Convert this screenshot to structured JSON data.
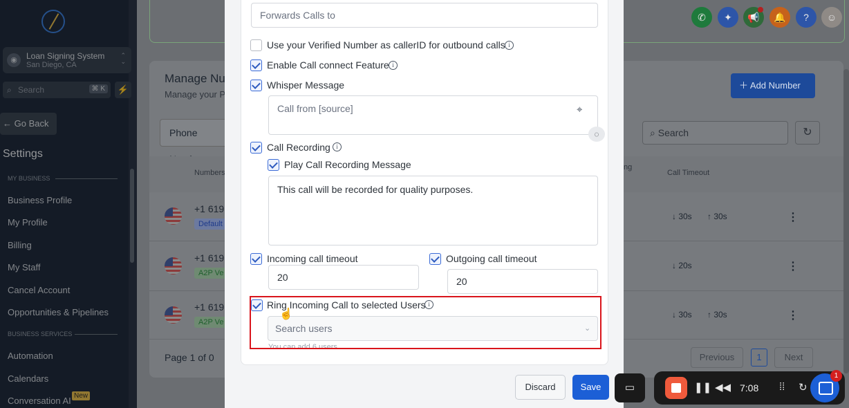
{
  "sidebar": {
    "logo_text": "",
    "account": {
      "name": "Loan Signing System",
      "location": "San Diego, CA"
    },
    "search": {
      "placeholder": "Search",
      "shortcut": "⌘ K"
    },
    "go_back": "← Go Back",
    "title": "Settings",
    "sections": [
      {
        "label": "MY BUSINESS"
      },
      {
        "label": "BUSINESS SERVICES"
      }
    ],
    "items": [
      {
        "label": "Business Profile"
      },
      {
        "label": "My Profile"
      },
      {
        "label": "Billing"
      },
      {
        "label": "My Staff"
      },
      {
        "label": "Cancel Account"
      },
      {
        "label": "Opportunities & Pipelines"
      },
      {
        "label": "Automation"
      },
      {
        "label": "Calendars"
      },
      {
        "label": "Conversation AI",
        "badge": "New"
      }
    ]
  },
  "header": {
    "icons": [
      "phone-icon",
      "sparkle-icon",
      "megaphone-icon",
      "bell-icon",
      "help-icon",
      "user-avatar"
    ],
    "colors": {
      "phone": "#1e7a3c",
      "sparkle": "#2d55a8",
      "megaphone": "#2f6a3a",
      "bell": "#c6621b",
      "help": "#2d55a8"
    }
  },
  "page": {
    "title": "Manage Nu",
    "subtitle": "Manage your P",
    "add_number": "Add Number",
    "tab_phone": "Phone Numbe",
    "search_placeholder": "Search",
    "columns": {
      "numbers": "Numbers",
      "ng": "ng",
      "call_timeout": "Call Timeout"
    },
    "rows": [
      {
        "number": "+1 619",
        "tag": "Default",
        "in": "↓ 30s",
        "out": "↑ 30s"
      },
      {
        "number": "+1 619",
        "tag": "A2P Ve",
        "in": "↓ 20s",
        "out": ""
      },
      {
        "number": "+1 619",
        "tag": "A2P Ve",
        "in": "↓ 30s",
        "out": "↑ 30s"
      }
    ],
    "pagination": {
      "info": "Page 1 of 0",
      "previous": "Previous",
      "current": "1",
      "next": "Next"
    }
  },
  "modal": {
    "forward_placeholder": "Forwards Calls to",
    "options": {
      "verified_callerid": {
        "label": "Use your Verified Number as callerID for outbound calls",
        "checked": false
      },
      "call_connect": {
        "label": "Enable Call connect Feature",
        "checked": true
      },
      "whisper": {
        "label": "Whisper Message",
        "checked": true,
        "placeholder": "Call from [source]"
      },
      "recording": {
        "label": "Call Recording",
        "checked": true
      },
      "play_recording_msg": {
        "label": "Play Call Recording Message",
        "checked": true,
        "message": "This call will be recorded for quality purposes."
      },
      "incoming_timeout": {
        "label": "Incoming call timeout",
        "checked": true,
        "value": "20"
      },
      "outgoing_timeout": {
        "label": "Outgoing call timeout",
        "checked": true,
        "value": "20"
      },
      "ring_users": {
        "label": "Ring Incoming Call to selected Users",
        "checked": true,
        "placeholder": "Search users",
        "helper": "You can add 6 users"
      }
    },
    "discard": "Discard",
    "save": "Save",
    "highlight_color": "#d9141b"
  },
  "recorder": {
    "time": "7:08",
    "badge": "1"
  }
}
